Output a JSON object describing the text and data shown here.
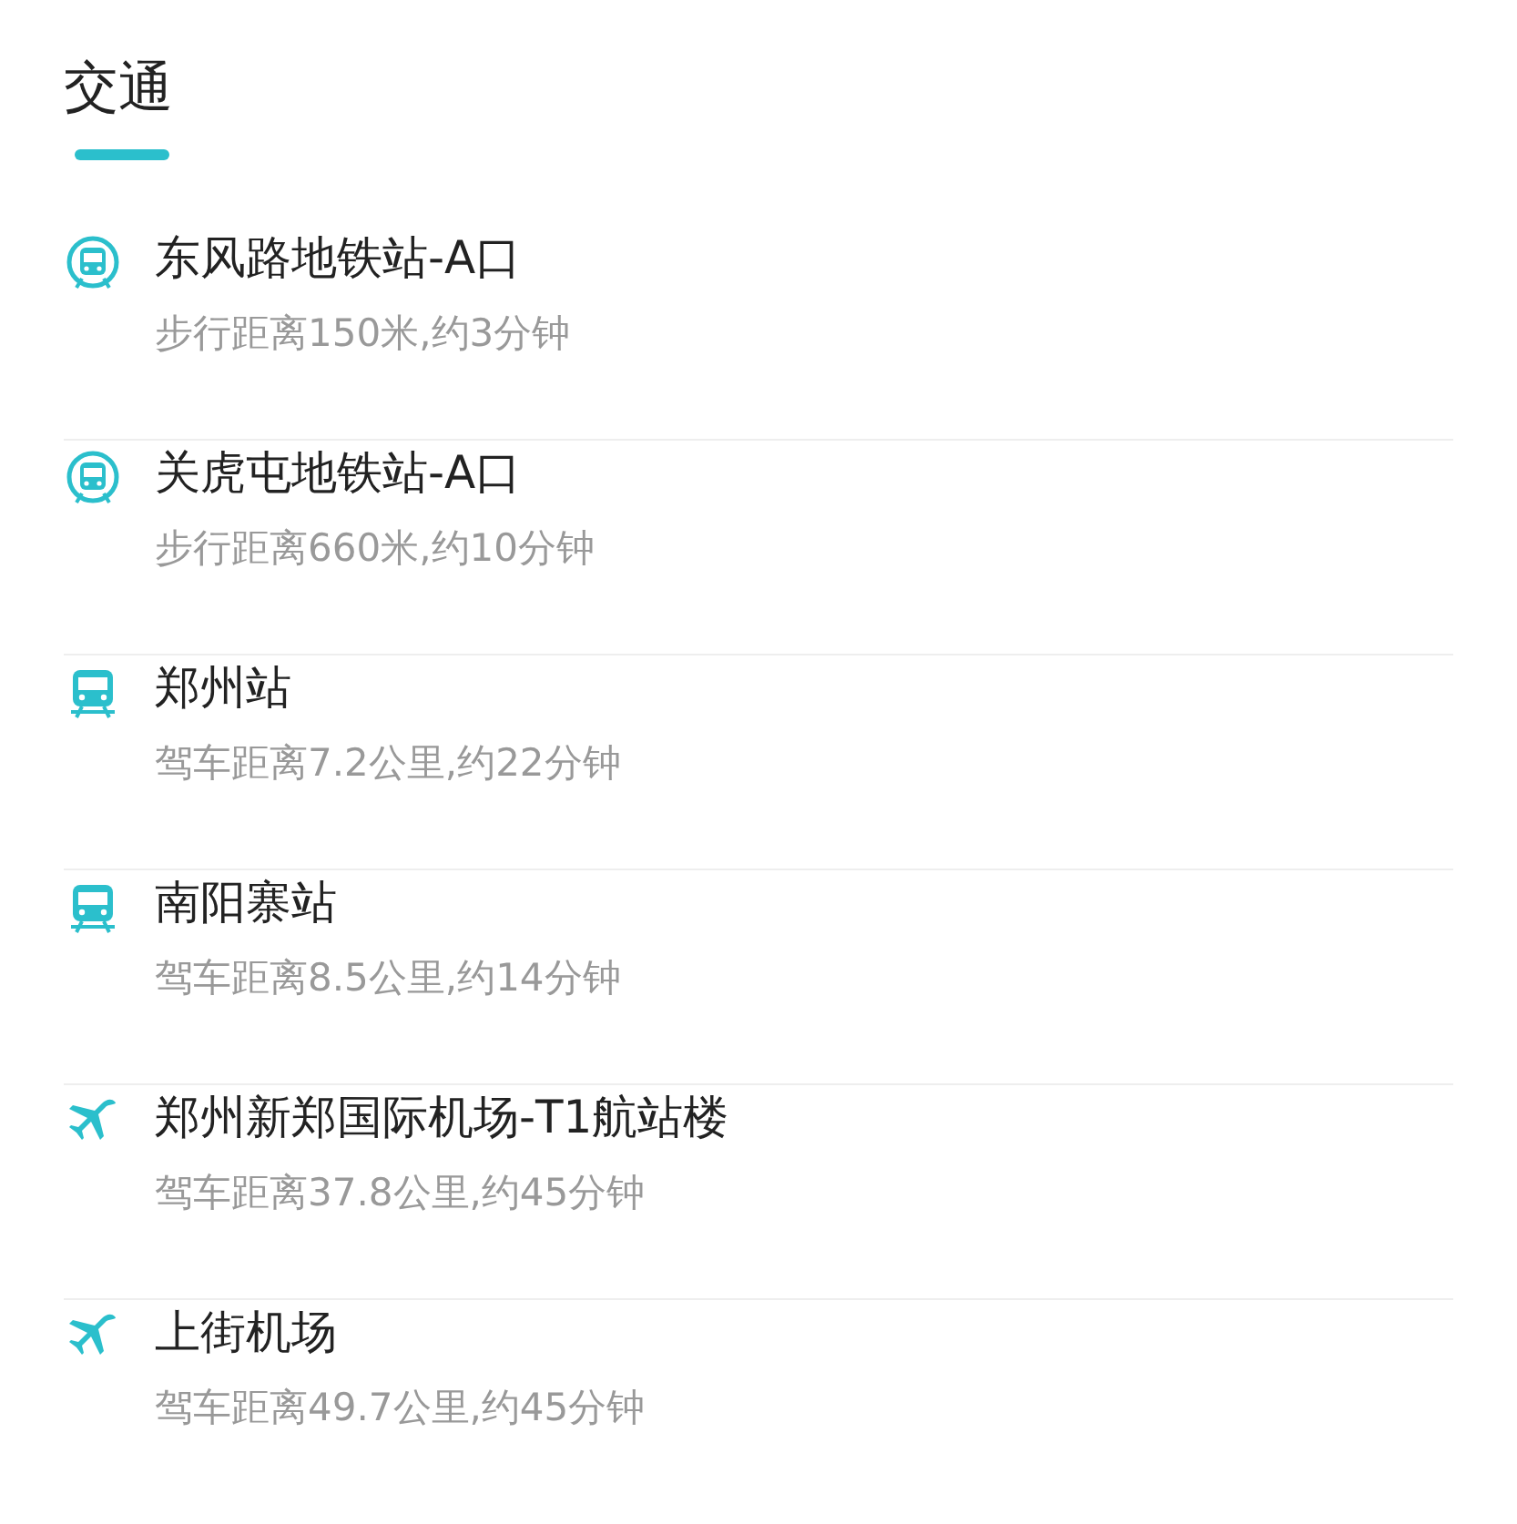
{
  "section": {
    "title": "交通"
  },
  "items": [
    {
      "kind": "metro",
      "name": "东风路地铁站-A口",
      "detail": "步行距离150米,约3分钟"
    },
    {
      "kind": "metro",
      "name": "关虎屯地铁站-A口",
      "detail": "步行距离660米,约10分钟"
    },
    {
      "kind": "train",
      "name": "郑州站",
      "detail": "驾车距离7.2公里,约22分钟"
    },
    {
      "kind": "train",
      "name": "南阳寨站",
      "detail": "驾车距离8.5公里,约14分钟"
    },
    {
      "kind": "plane",
      "name": "郑州新郑国际机场-T1航站楼",
      "detail": "驾车距离37.8公里,约45分钟"
    },
    {
      "kind": "plane",
      "name": "上街机场",
      "detail": "驾车距离49.7公里,约45分钟"
    }
  ]
}
